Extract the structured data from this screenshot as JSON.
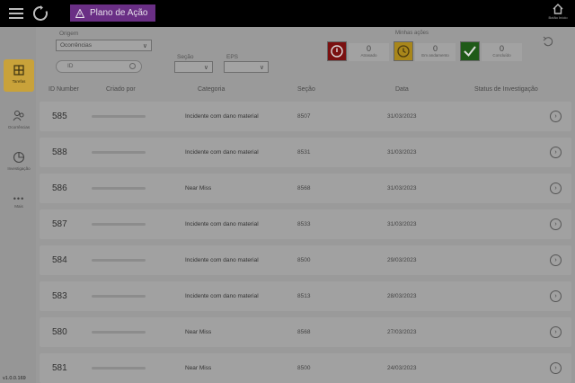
{
  "header": {
    "app_title": "Plano de Ação",
    "home_label": "Botão Início"
  },
  "sidebar": {
    "items": [
      {
        "label": "Tarefas",
        "icon": "tasks-icon",
        "active": true
      },
      {
        "label": "Ocorrências",
        "icon": "people-icon",
        "active": false
      },
      {
        "label": "Investigação",
        "icon": "pie-chart-icon",
        "active": false
      },
      {
        "label": "Mais",
        "icon": "more-dots-icon",
        "active": false
      }
    ],
    "version": "v1.0.0.169"
  },
  "filters": {
    "origem_label": "Origem",
    "origem_value": "Ocorrências",
    "search_placeholder": "ID",
    "secao_label": "Seção",
    "eps_label": "EPS"
  },
  "status": {
    "title": "Minhas ações",
    "cards": [
      {
        "count": "0",
        "caption": "Atrasado",
        "color": "#7a1010"
      },
      {
        "count": "0",
        "caption": "Em andamento",
        "color": "#a8861a"
      },
      {
        "count": "0",
        "caption": "Concluído",
        "color": "#1f5a18"
      }
    ]
  },
  "table": {
    "headers": [
      "ID Number",
      "Criado por",
      "Categoria",
      "Seção",
      "Data",
      "Status de Investigação"
    ],
    "rows": [
      {
        "id": "585",
        "categoria": "Incidente com dano material",
        "secao": "8507",
        "data": "31/03/2023"
      },
      {
        "id": "588",
        "categoria": "Incidente com dano material",
        "secao": "8531",
        "data": "31/03/2023"
      },
      {
        "id": "586",
        "categoria": "Near Miss",
        "secao": "8568",
        "data": "31/03/2023"
      },
      {
        "id": "587",
        "categoria": "Incidente com dano material",
        "secao": "8533",
        "data": "31/03/2023"
      },
      {
        "id": "584",
        "categoria": "Incidente com dano material",
        "secao": "8500",
        "data": "29/03/2023"
      },
      {
        "id": "583",
        "categoria": "Incidente com dano material",
        "secao": "8513",
        "data": "28/03/2023"
      },
      {
        "id": "580",
        "categoria": "Near Miss",
        "secao": "8568",
        "data": "27/03/2023"
      },
      {
        "id": "581",
        "categoria": "Near Miss",
        "secao": "8500",
        "data": "24/03/2023"
      }
    ]
  }
}
